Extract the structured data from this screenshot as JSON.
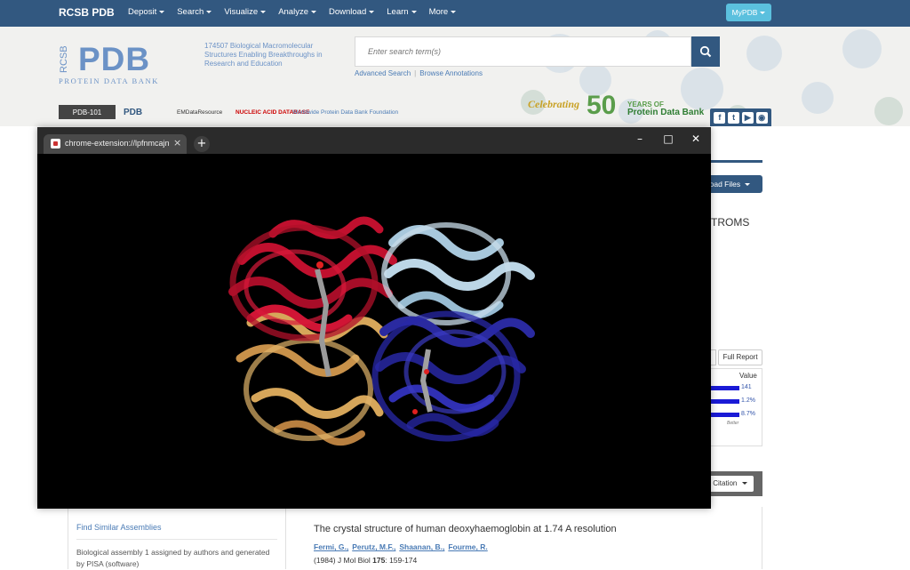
{
  "navbar": {
    "brand": "RCSB PDB",
    "items": [
      {
        "label": "Deposit"
      },
      {
        "label": "Search"
      },
      {
        "label": "Visualize"
      },
      {
        "label": "Analyze"
      },
      {
        "label": "Download"
      },
      {
        "label": "Learn"
      },
      {
        "label": "More"
      }
    ],
    "mypdb_label": "MyPDB"
  },
  "banner": {
    "logo_rcsb": "RCSB",
    "logo_pdb": "PDB",
    "logo_sub": "PROTEIN DATA BANK",
    "tagline": "174507 Biological Macromolecular Structures Enabling Breakthroughs in Research and Education",
    "search_placeholder": "Enter search term(s)",
    "advanced_search": "Advanced Search",
    "browse_annotations": "Browse Annotations",
    "partners": [
      "PDB-101",
      "PDB",
      "EMDataResource",
      "NUCLEIC ACID DATABASE",
      "Worldwide Protein Data Bank Foundation"
    ],
    "celebrating": "Celebrating",
    "fifty": "50",
    "years_of": "YEARS OF",
    "years_pdb": "Protein Data Bank",
    "social": [
      "f",
      "t",
      "▶",
      "◉"
    ]
  },
  "page": {
    "download_files": "nload Files",
    "troms": "TROMS",
    "full_report": "Full Report",
    "value_header": "Value",
    "values": [
      "141",
      "1.2%",
      "8.7%"
    ],
    "better": "Better",
    "cite_label": "y Citation"
  },
  "sidebar": {
    "find_similar": "Find Similar Assemblies",
    "assembly_note": "Biological assembly 1 assigned by authors and generated by PISA (software)"
  },
  "citation": {
    "title": "The crystal structure of human deoxyhaemoglobin at 1.74 A resolution",
    "authors": [
      "Fermi, G.,",
      "Perutz, M.F.,",
      "Shaanan, B.,",
      "Fourme, R."
    ],
    "journal_prefix": "(1984) J Mol Biol",
    "volume": "175",
    "pages": ": 159-174"
  },
  "popup": {
    "tab_title": "chrome-extension://lpfnmcajn",
    "tab_close": "×",
    "new_tab": "+",
    "minimize": "–",
    "maximize": "□",
    "close": "✕"
  },
  "colors": {
    "navbar": "#325880",
    "chain_red": "#c0102e",
    "chain_light_blue": "#a8c8dc",
    "chain_tan": "#d6a65a",
    "chain_dark_blue": "#2a2aa0"
  }
}
